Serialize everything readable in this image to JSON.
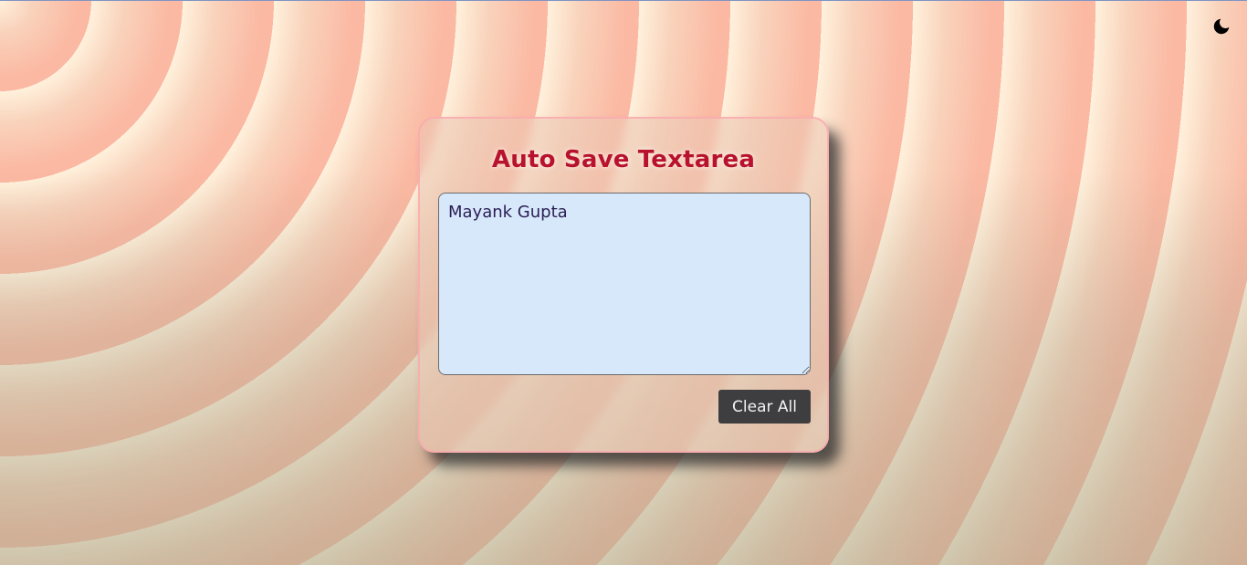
{
  "header": {
    "theme_toggle_icon": "moon-icon"
  },
  "card": {
    "title": "Auto Save Textarea",
    "textarea_value": "Mayank Gupta",
    "clear_button_label": "Clear All"
  },
  "colors": {
    "title": "#b8122d",
    "textarea_bg": "#d7e8fb",
    "button_bg": "#3e3e40",
    "background_light": "#fff1dc",
    "background_dark": "#fbb8a2"
  }
}
